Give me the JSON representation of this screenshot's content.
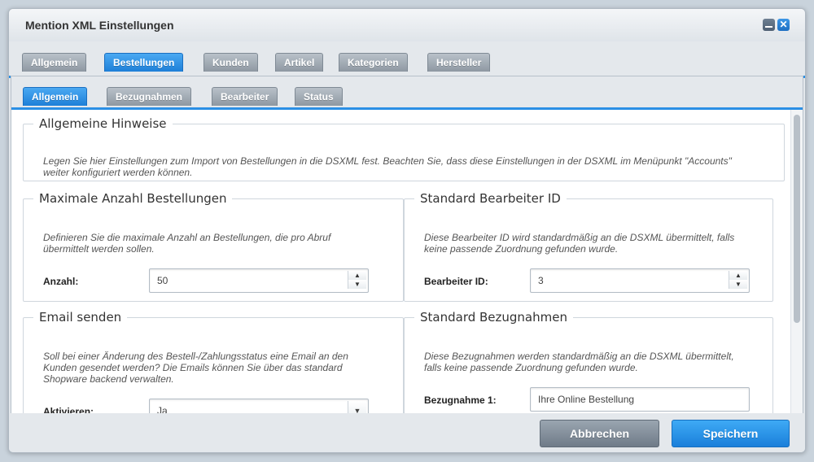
{
  "window": {
    "title": "Mention XML Einstellungen"
  },
  "main_tabs": [
    {
      "label": "Allgemein"
    },
    {
      "label": "Bestellungen"
    },
    {
      "label": "Kunden"
    },
    {
      "label": "Artikel"
    },
    {
      "label": "Kategorien"
    },
    {
      "label": "Hersteller"
    }
  ],
  "sub_tabs": [
    {
      "label": "Allgemein"
    },
    {
      "label": "Bezugnahmen"
    },
    {
      "label": "Bearbeiter"
    },
    {
      "label": "Status"
    }
  ],
  "general_hints": {
    "legend": "Allgemeine Hinweise",
    "text": "Legen Sie hier Einstellungen zum Import von Bestellungen in die DSXML fest. Beachten Sie, dass diese Einstellungen in der DSXML im Menüpunkt \"Accounts\" weiter konfiguriert werden können."
  },
  "max_orders": {
    "legend": "Maximale Anzahl Bestellungen",
    "text": "Definieren Sie die maximale Anzahl an Bestellungen, die pro Abruf übermittelt werden sollen.",
    "label": "Anzahl:",
    "value": "50"
  },
  "default_editor": {
    "legend": "Standard Bearbeiter ID",
    "text": "Diese Bearbeiter ID wird standardmäßig an die DSXML übermittelt, falls keine passende Zuordnung gefunden wurde.",
    "label": "Bearbeiter ID:",
    "value": "3"
  },
  "send_email": {
    "legend": "Email senden",
    "text": "Soll bei einer Änderung des Bestell-/Zahlungsstatus eine Email an den Kunden gesendet werden? Die Emails können Sie über das standard Shopware backend verwalten.",
    "label": "Aktivieren:",
    "value": "Ja"
  },
  "default_references": {
    "legend": "Standard Bezugnahmen",
    "text": "Diese Bezugnahmen werden standardmäßig an die DSXML übermittelt, falls keine passende Zuordnung gefunden wurde.",
    "label": "Bezugnahme 1:",
    "value": "Ihre Online Bestellung"
  },
  "footer": {
    "cancel_label": "Abbrechen",
    "save_label": "Speichern"
  },
  "colors": {
    "accent": "#2b8fe5",
    "tab_inactive": "#8e98a2"
  }
}
